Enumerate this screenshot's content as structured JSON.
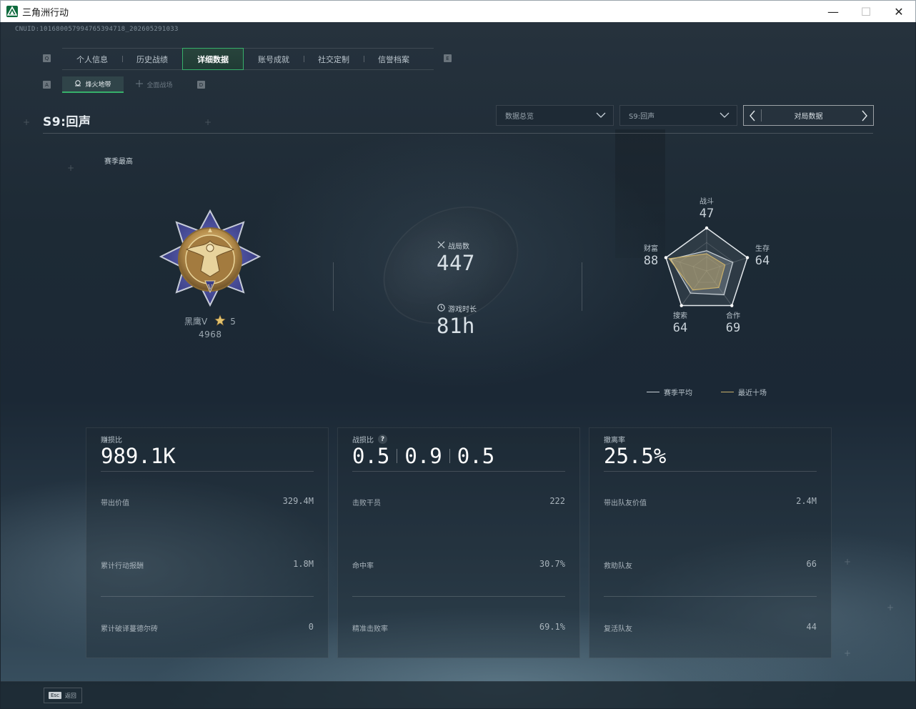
{
  "window": {
    "title": "三角洲行动",
    "minimize": "—",
    "maximize": "☐",
    "close": "✕"
  },
  "uid": "CNUID:101680057994765394718_202605291033",
  "hotkeys": {
    "q": "Q",
    "e": "E",
    "a": "A",
    "d": "D"
  },
  "main_tabs": [
    {
      "label": "个人信息",
      "active": false
    },
    {
      "label": "历史战绩",
      "active": false
    },
    {
      "label": "详细数据",
      "active": true
    },
    {
      "label": "账号成就",
      "active": false
    },
    {
      "label": "社交定制",
      "active": false
    },
    {
      "label": "信誉档案",
      "active": false
    }
  ],
  "sub_tabs": [
    {
      "label": "烽火地带",
      "icon": "map-icon",
      "active": true
    },
    {
      "label": "全面战场",
      "icon": "crosshair-icon",
      "active": false
    }
  ],
  "section_title": "S9:回声",
  "dropdowns": {
    "overview": "数据总览",
    "season": "S9:回声"
  },
  "match_nav": {
    "label": "对局数据"
  },
  "rank": {
    "heading": "赛季最高",
    "name": "黑鹰V",
    "stars": "5",
    "score": "4968"
  },
  "summary": {
    "matches_label": "战局数",
    "matches_value": "447",
    "playtime_label": "游戏时长",
    "playtime_value": "81h"
  },
  "radar": {
    "axes": [
      {
        "label": "战斗",
        "value": "47",
        "season_avg": 0.47,
        "recent": 0.4
      },
      {
        "label": "生存",
        "value": "64",
        "season_avg": 0.64,
        "recent": 0.45
      },
      {
        "label": "合作",
        "value": "69",
        "season_avg": 0.69,
        "recent": 0.48
      },
      {
        "label": "搜索",
        "value": "64",
        "season_avg": 0.64,
        "recent": 0.55
      },
      {
        "label": "财富",
        "value": "88",
        "season_avg": 0.88,
        "recent": 0.92
      }
    ],
    "legend_season": "赛季平均",
    "legend_recent": "最近十场",
    "colors": {
      "season": "#c9d1d7",
      "recent": "#c9b06a"
    }
  },
  "cards": [
    {
      "title": "赚损比",
      "big": "989.1K",
      "rows": [
        {
          "label": "带出价值",
          "value": "329.4M"
        },
        {
          "label": "累计行动报酬",
          "value": "1.8M"
        },
        {
          "label": "累计破译蔓德尔砖",
          "value": "0"
        }
      ]
    },
    {
      "title": "战损比",
      "big_values": [
        "0.5",
        "0.9",
        "0.5"
      ],
      "help": "?",
      "rows": [
        {
          "label": "击败干员",
          "value": "222"
        },
        {
          "label": "命中率",
          "value": "30.7%"
        },
        {
          "label": "精准击败率",
          "value": "69.1%"
        }
      ]
    },
    {
      "title": "撤离率",
      "big": "25.5%",
      "rows": [
        {
          "label": "带出队友价值",
          "value": "2.4M"
        },
        {
          "label": "救助队友",
          "value": "66"
        },
        {
          "label": "复活队友",
          "value": "44"
        }
      ]
    }
  ],
  "bottom": {
    "esc_key": "Esc",
    "esc_label": "返回"
  }
}
